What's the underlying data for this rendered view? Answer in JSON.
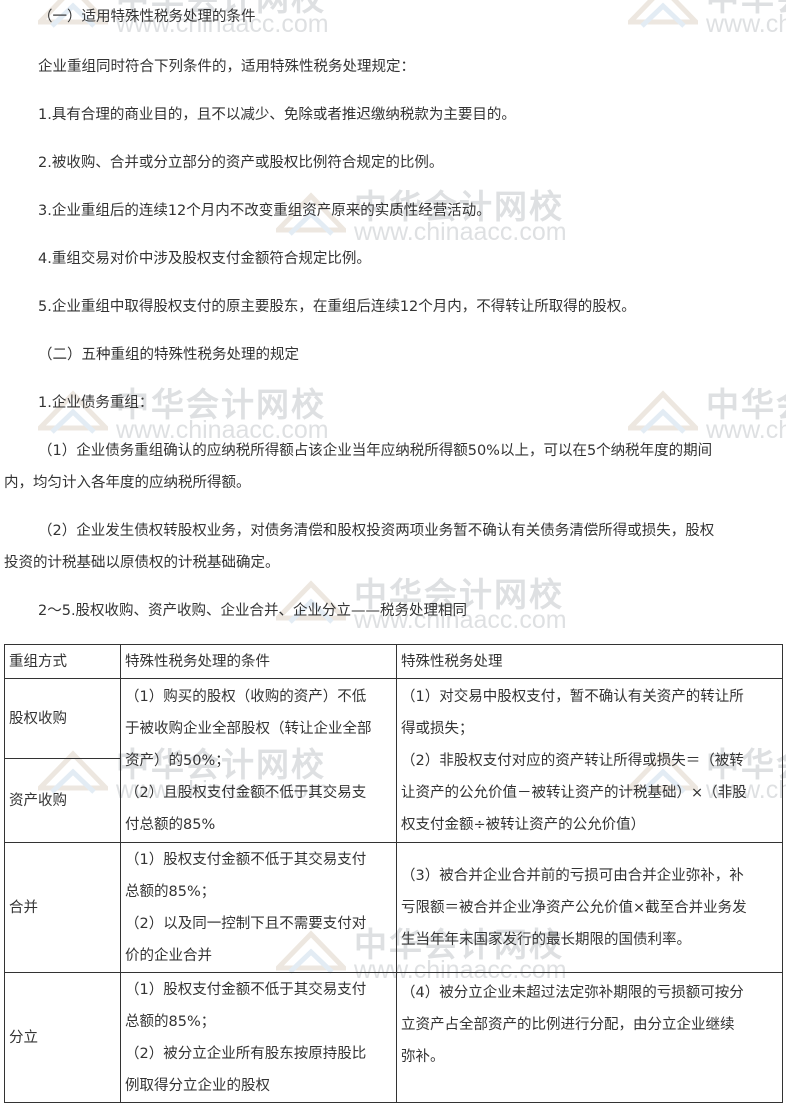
{
  "watermark": {
    "cn": "中华会计网校",
    "url": "www.chinaacc.com"
  },
  "section1": {
    "heading": "（一）适用特殊性税务处理的条件",
    "intro": "企业重组同时符合下列条件的，适用特殊性税务处理规定：",
    "items": [
      "1.具有合理的商业目的，且不以减少、免除或者推迟缴纳税款为主要目的。",
      "2.被收购、合并或分立部分的资产或股权比例符合规定的比例。",
      "3.企业重组后的连续12个月内不改变重组资产原来的实质性经营活动。",
      "4.重组交易对价中涉及股权支付金额符合规定比例。",
      "5.企业重组中取得股权支付的原主要股东，在重组后连续12个月内，不得转让所取得的股权。"
    ]
  },
  "section2": {
    "heading": "（二）五种重组的特殊性税务处理的规定",
    "sub1": "1.企业债务重组：",
    "p1_line1": "（1）企业债务重组确认的应纳税所得额占该企业当年应纳税所得额50%以上，可以在5个纳税年度的期间",
    "p1_line2": "内，均匀计入各年度的应纳税所得额。",
    "p2_line1": "（2）企业发生债权转股权业务，对债务清偿和股权投资两项业务暂不确认有关债务清偿所得或损失，股权",
    "p2_line2": "投资的计税基础以原债权的计税基础确定。",
    "sub2": "2～5.股权收购、资产收购、企业合并、企业分立——税务处理相同"
  },
  "table": {
    "headers": [
      "重组方式",
      "特殊性税务处理的条件",
      "特殊性税务处理"
    ],
    "rows": {
      "equity": "股权收购",
      "asset": "资产收购",
      "merge": "合并",
      "split": "分立"
    },
    "cond_acq": [
      "（1）购买的股权（收购的资产）不低",
      "于被收购企业全部股权（转让企业全部",
      "资产）的50%；",
      "（2）且股权支付金额不低于其交易支",
      "付总额的85%"
    ],
    "treat_acq": [
      "（1）对交易中股权支付，暂不确认有关资产的转让所",
      "得或损失；",
      "（2）非股权支付对应的资产转让所得或损失＝（被转",
      "让资产的公允价值－被转让资产的计税基础）×（非股",
      "权支付金额÷被转让资产的公允价值）"
    ],
    "cond_merge": [
      "（1）股权支付金额不低于其交易支付",
      "总额的85%；",
      "（2）以及同一控制下且不需要支付对",
      "价的企业合并"
    ],
    "treat_merge": [
      "（3）被合并企业合并前的亏损可由合并企业弥补，补",
      "亏限额＝被合并企业净资产公允价值×截至合并业务发",
      "生当年年末国家发行的最长期限的国债利率。"
    ],
    "cond_split": [
      "（1）股权支付金额不低于其交易支付",
      "总额的85%；",
      "（2）被分立企业所有股东按原持股比",
      "例取得分立企业的股权"
    ],
    "treat_split": [
      "（4）被分立企业未超过法定弥补期限的亏损额可按分",
      "立资产占全部资产的比例进行分配，由分立企业继续",
      "弥补。"
    ]
  }
}
